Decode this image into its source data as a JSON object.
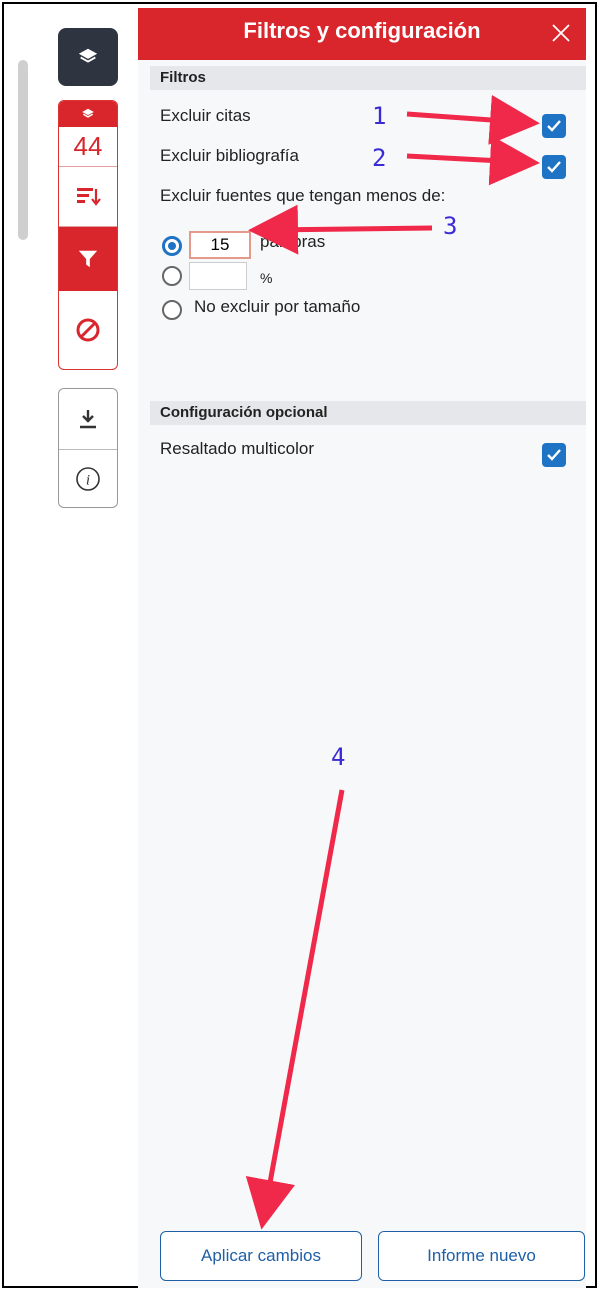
{
  "panel": {
    "title": "Filtros y configuración",
    "header_color": "#d9262c"
  },
  "toolbar": {
    "match_count": "44",
    "icons": [
      "layers-icon",
      "layers-small-icon",
      "sort-icon",
      "filter-icon",
      "block-icon",
      "download-icon",
      "info-icon"
    ]
  },
  "filters": {
    "section_title": "Filtros",
    "exclude_citations": {
      "label": "Excluir citas",
      "checked": true
    },
    "exclude_bibliography": {
      "label": "Excluir bibliografía",
      "checked": true
    },
    "min_size_label": "Excluir fuentes que tengan menos de:",
    "words_value": "15",
    "words_label": "palabras",
    "percent_value": "",
    "percent_label": "%",
    "no_exclude_label": "No excluir por tamaño"
  },
  "optional": {
    "section_title": "Configuración opcional",
    "multicolor": {
      "label": "Resaltado multicolor",
      "checked": true
    }
  },
  "actions": {
    "apply_label": "Aplicar cambios",
    "new_report_label": "Informe nuevo"
  },
  "annotations": [
    "1",
    "2",
    "3",
    "4"
  ],
  "colors": {
    "accent": "#d9262c",
    "checkbox": "#1f73c4",
    "button_text": "#1f5fa6",
    "annotation": "#3a2bd6",
    "arrow": "#f0284a"
  }
}
